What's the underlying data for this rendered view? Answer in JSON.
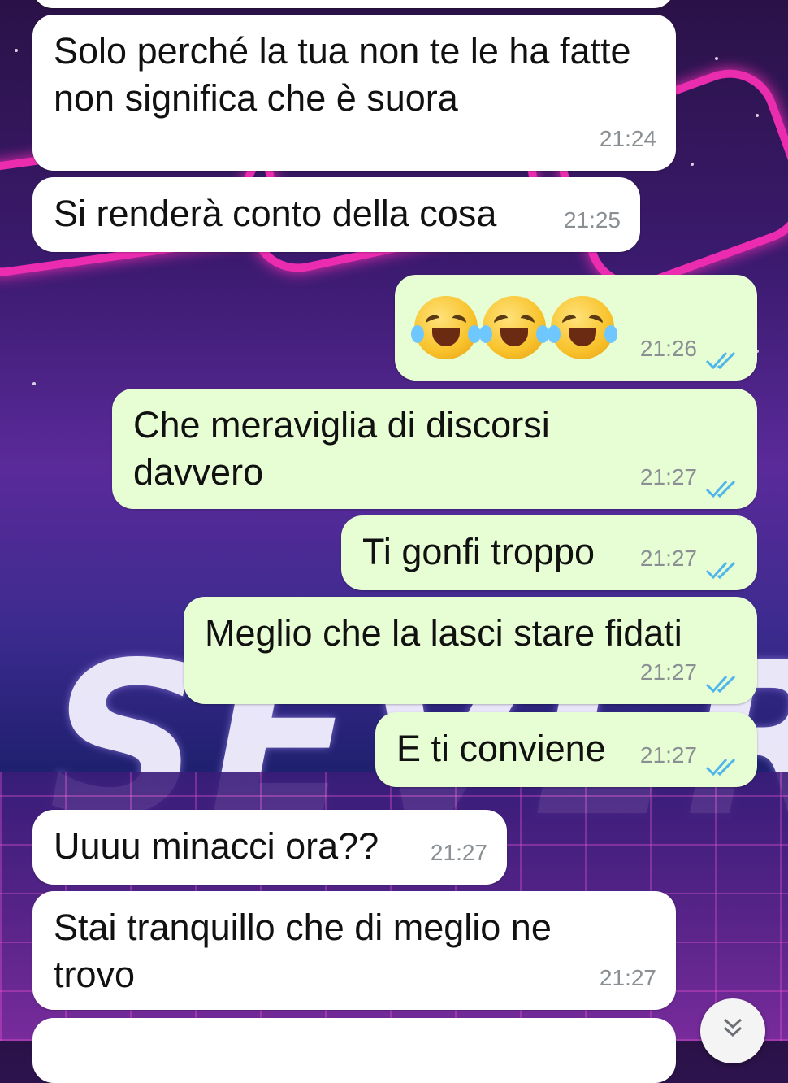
{
  "messages": [
    {
      "direction": "incoming",
      "text": "Solo perché la tua non te le ha fatte non significa che è suora",
      "time": "21:24"
    },
    {
      "direction": "incoming",
      "text": "Si renderà conto della cosa",
      "time": "21:25"
    },
    {
      "direction": "outgoing",
      "emoji": "rolling-on-floor-laughing",
      "count": 3,
      "time": "21:26",
      "status": "read"
    },
    {
      "direction": "outgoing",
      "text": "Che meraviglia di discorsi davvero",
      "time": "21:27",
      "status": "read"
    },
    {
      "direction": "outgoing",
      "text": "Ti gonfi troppo",
      "time": "21:27",
      "status": "read"
    },
    {
      "direction": "outgoing",
      "text": "Meglio che la lasci stare fidati",
      "time": "21:27",
      "status": "read"
    },
    {
      "direction": "outgoing",
      "text": "E ti conviene",
      "time": "21:27",
      "status": "read"
    },
    {
      "direction": "incoming",
      "text": "Uuuu minacci ora??",
      "time": "21:27"
    },
    {
      "direction": "incoming",
      "text": "Stai tranquillo che di meglio ne trovo",
      "time": "21:27"
    }
  ],
  "colors": {
    "incoming_bubble": "#ffffff",
    "outgoing_bubble": "#e7fdd3",
    "read_ticks": "#4fb6ec",
    "timestamp": "#8a8f93"
  },
  "icons": {
    "read_receipt": "double-check-icon",
    "scroll_down": "chevron-double-down-icon"
  }
}
